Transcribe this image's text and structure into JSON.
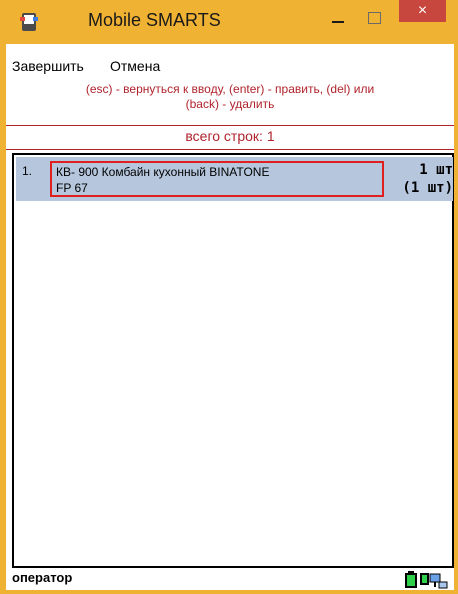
{
  "window": {
    "title": "Mobile SMARTS",
    "close_glyph": "×"
  },
  "menu": {
    "items": [
      {
        "label": "Завершить"
      },
      {
        "label": "Отмена"
      }
    ]
  },
  "hint": {
    "line1": "(esc) - вернуться к вводу, (enter) - править, (del) или",
    "line2": "(back) - удалить"
  },
  "summary": {
    "text": "всего строк: 1"
  },
  "list": {
    "rows": [
      {
        "number": "1.",
        "name_line1": "КВ- 900 Комбайн кухонный BINATONE",
        "name_line2": "FP 67",
        "qty": "1 шт",
        "qty_total": "(1 шт)"
      }
    ]
  },
  "status_bar": {
    "user": "оператор"
  },
  "colors": {
    "frame": "#f0b232",
    "close_button": "#c7463d",
    "hint_text": "#b0232c",
    "selected_row": "#b6c6dc",
    "highlight_border": "#e01f1f"
  },
  "icons": [
    "app-icon",
    "minimize-icon",
    "maximize-icon",
    "close-icon",
    "battery-icon",
    "network-icon"
  ]
}
